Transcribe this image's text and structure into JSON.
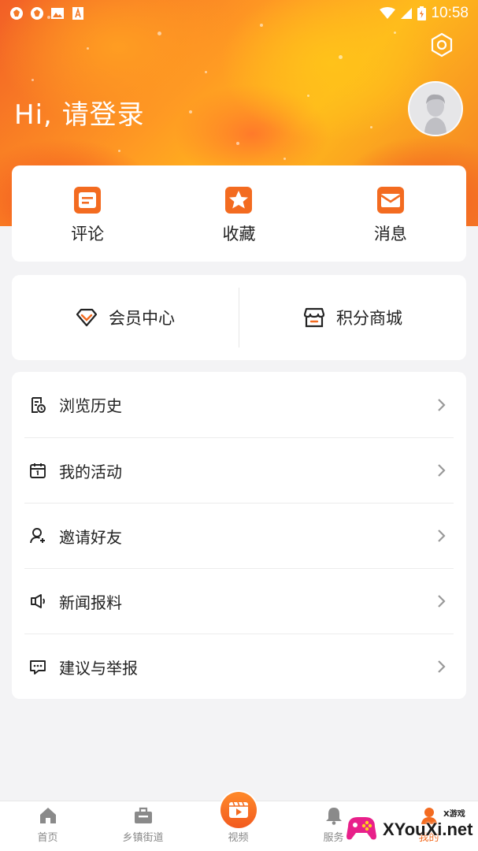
{
  "status_bar": {
    "time": "10:58",
    "left_icons": [
      "weibo-icon",
      "weibo-icon",
      "image-icon",
      "font-icon"
    ],
    "right_icons": [
      "wifi-icon",
      "signal-icon",
      "battery-icon"
    ]
  },
  "header": {
    "greeting": "Hi, 请登录",
    "settings_icon": "settings-hexagon-icon",
    "avatar_icon": "default-avatar-icon"
  },
  "quick_actions": [
    {
      "label": "评论",
      "icon": "comment-icon"
    },
    {
      "label": "收藏",
      "icon": "star-icon"
    },
    {
      "label": "消息",
      "icon": "mail-icon"
    }
  ],
  "member": {
    "center_label": "会员中心",
    "center_icon": "diamond-icon",
    "mall_label": "积分商城",
    "mall_icon": "store-icon"
  },
  "menu": [
    {
      "label": "浏览历史",
      "icon": "history-icon"
    },
    {
      "label": "我的活动",
      "icon": "calendar-icon"
    },
    {
      "label": "邀请好友",
      "icon": "invite-user-icon"
    },
    {
      "label": "新闻报料",
      "icon": "speaker-icon"
    },
    {
      "label": "建议与举报",
      "icon": "feedback-icon"
    }
  ],
  "bottom_nav": [
    {
      "label": "首页",
      "icon": "home-icon"
    },
    {
      "label": "乡镇街道",
      "icon": "briefcase-icon"
    },
    {
      "label": "视频",
      "icon": "video-icon"
    },
    {
      "label": "服务",
      "icon": "bell-icon"
    },
    {
      "label": "我的",
      "icon": "user-icon"
    }
  ],
  "watermark": {
    "text": "XYouXi.net",
    "small_text": "X游戏"
  },
  "colors": {
    "accent": "#f36b20",
    "background": "#f3f3f5",
    "text": "#222222",
    "nav_label": "#888888"
  }
}
